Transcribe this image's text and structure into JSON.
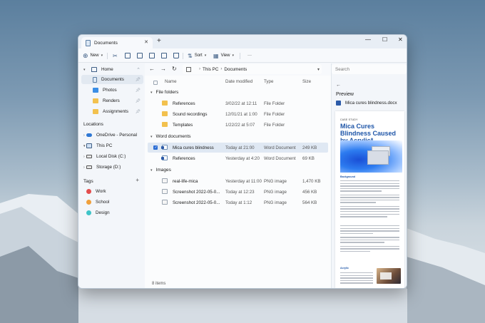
{
  "window": {
    "tab_title": "Documents",
    "tab_close": "✕",
    "new_tab": "+",
    "minimize": "—",
    "maximize": "☐",
    "close": "✕"
  },
  "toolbar": {
    "new_label": "New",
    "sort_label": "Sort",
    "view_label": "View",
    "more_label": "···"
  },
  "sidebar": {
    "home": "Home",
    "quick": [
      "Documents",
      "Photos",
      "Renders",
      "Assignments"
    ],
    "locations_header": "Locations",
    "locations": [
      "OneDrive - Personal",
      "This PC",
      "Local Disk (C:)",
      "Storage (D:)"
    ],
    "tags_header": "Tags",
    "tags": [
      {
        "label": "Work",
        "color": "#e34d4d"
      },
      {
        "label": "School",
        "color": "#f0a03c"
      },
      {
        "label": "Design",
        "color": "#3ec4c8"
      }
    ]
  },
  "address": {
    "back": "←",
    "forward": "→",
    "refresh": "↻",
    "crumbs": [
      "This PC",
      "Documents"
    ],
    "search_placeholder": "Search"
  },
  "columns": {
    "name": "Name",
    "date": "Date modified",
    "type": "Type",
    "size": "Size"
  },
  "groups": [
    {
      "label": "File folders",
      "rows": [
        {
          "name": "References",
          "date": "3/02/22 at 12:11",
          "type": "File Folder",
          "size": ""
        },
        {
          "name": "Sound recordings",
          "date": "12/01/21 at 1:00",
          "type": "File Folder",
          "size": ""
        },
        {
          "name": "Templates",
          "date": "1/22/22 at 5:07",
          "type": "File Folder",
          "size": ""
        }
      ]
    },
    {
      "label": "Word documents",
      "rows": [
        {
          "name": "Mica cures blindness",
          "date": "Today at 21:00",
          "type": "Word Document",
          "size": "249 KB"
        },
        {
          "name": "References",
          "date": "Yesterday at 4:20",
          "type": "Word Document",
          "size": "69 KB"
        }
      ]
    },
    {
      "label": "Images",
      "rows": [
        {
          "name": "real-life-mica",
          "date": "Yesterday at 11:00",
          "type": "PNG image",
          "size": "1,470 KB"
        },
        {
          "name": "Screenshot 2022-05-0...",
          "date": "Today at 12:23",
          "type": "PNG image",
          "size": "456 KB"
        },
        {
          "name": "Screenshot 2022-05-0...",
          "date": "Today at 1:12",
          "type": "PNG image",
          "size": "564 KB"
        }
      ]
    }
  ],
  "status": "8 items",
  "preview": {
    "back": "←",
    "title": "Preview",
    "file": "Mica cures blindness.docx",
    "doc_kicker": "CASE STUDY",
    "doc_heading": "Mica Cures Blindness Caused by Acrylic*",
    "doc_section1": "Background",
    "doc_section2": "Acrylic"
  },
  "colors": {
    "accent": "#2b6dd4",
    "folder": "#f2c14e",
    "doc_heading": "#1f56a8"
  }
}
